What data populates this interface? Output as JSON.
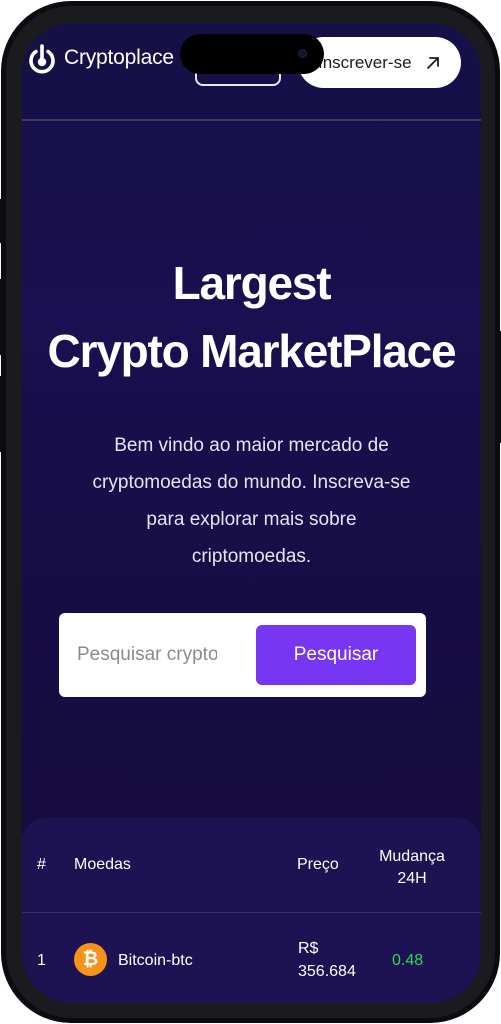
{
  "header": {
    "brand": "Cryptoplace",
    "signup_label": "Inscrever-se"
  },
  "hero": {
    "title_lines": [
      "Largest",
      "Crypto MarketPlace"
    ],
    "subtitle_lines": [
      "Bem vindo ao maior mercado de",
      "cryptomoedas do mundo. Inscreva-se",
      "para explorar mais sobre",
      "criptomoedas."
    ]
  },
  "search": {
    "placeholder": "Pesquisar crypto...",
    "button_label": "Pesquisar"
  },
  "table": {
    "headers": {
      "rank": "#",
      "coin": "Moedas",
      "price": "Preço",
      "change_lines": [
        "Mudança",
        "24H"
      ]
    },
    "rows": [
      {
        "rank": "1",
        "icon": "bitcoin-icon",
        "icon_symbol": "₿",
        "name": "Bitcoin-btc",
        "price_lines": [
          "R$",
          "356.684"
        ],
        "change": "0.48"
      }
    ]
  },
  "colors": {
    "background": "#170d45",
    "accent": "#7636f2",
    "positive": "#2fd65a",
    "bitcoin": "#f7931a"
  }
}
